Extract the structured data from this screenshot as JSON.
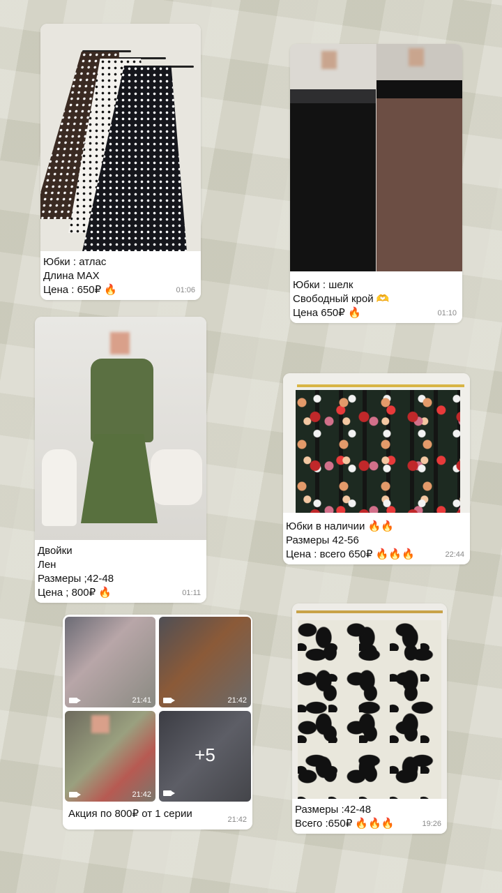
{
  "posts": [
    {
      "lines": [
        "Юбки : атлас",
        "Длина MAX",
        "Цена : 650₽ 🔥"
      ],
      "time": "01:06"
    },
    {
      "lines": [
        "Юбки : шелк",
        "Свободный крой 🫶",
        "Цена 650₽ 🔥"
      ],
      "time": "01:10"
    },
    {
      "lines": [
        "Двойки",
        "Лен",
        "Размеры ;42-48",
        "Цена ; 800₽ 🔥"
      ],
      "time": "01:11"
    },
    {
      "lines": [
        "Юбки в наличии 🔥🔥",
        "Размеры 42-56",
        "Цена : всего 650₽ 🔥🔥🔥"
      ],
      "time": "22:44"
    },
    {
      "lines": [
        "Акция по 800₽ от 1 серии"
      ],
      "time": "21:42",
      "videos": [
        {
          "time": "21:41"
        },
        {
          "time": "21:42"
        },
        {
          "time": "21:42"
        }
      ],
      "more": "+5"
    },
    {
      "lines": [
        "Размеры :42-48",
        "Всего :650₽ 🔥🔥🔥"
      ],
      "time": "19:26"
    }
  ],
  "icons": {
    "video": "video-camera-icon"
  },
  "colors": {
    "caption_text": "#111111",
    "time_text": "#888888",
    "background": "#d7d6c8"
  }
}
